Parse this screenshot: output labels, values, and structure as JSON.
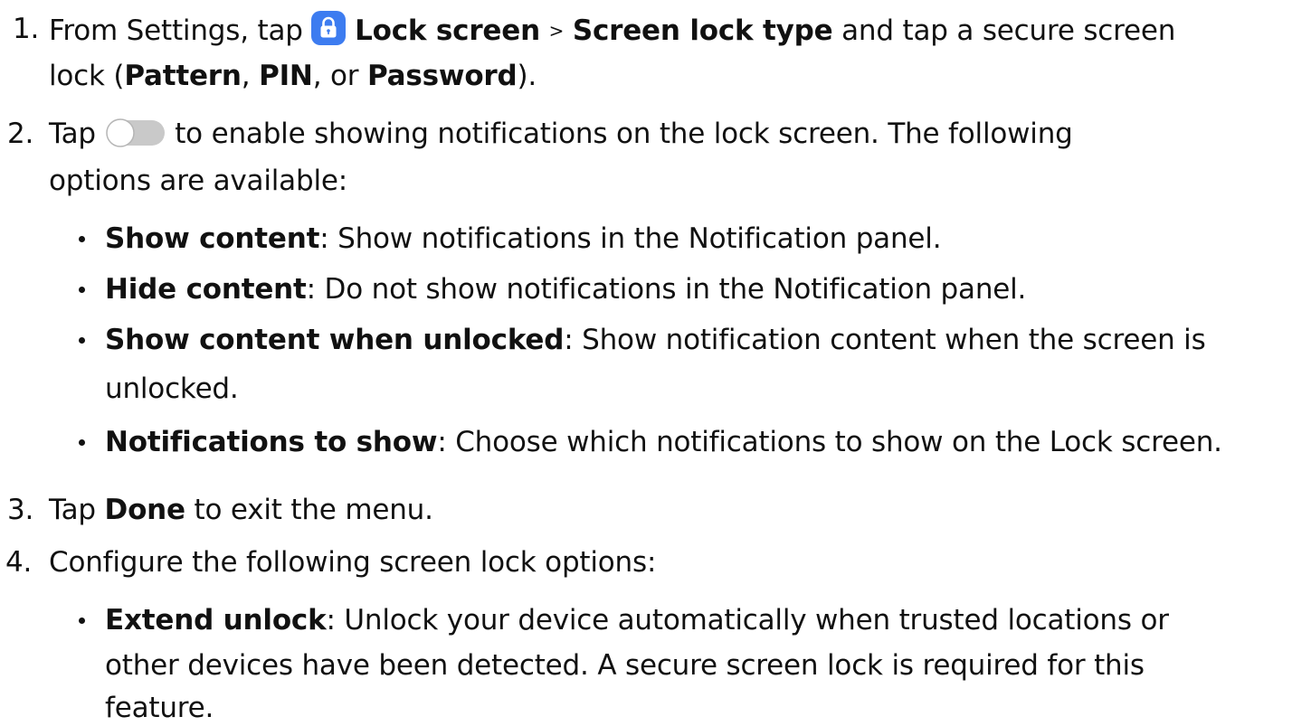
{
  "steps": [
    {
      "num": "1.",
      "t1": "From Settings, tap",
      "icon": "lock-icon",
      "b1": "Lock screen",
      "arrow": ">",
      "b2": "Screen lock type",
      "t2": "and tap a secure screen",
      "t3": "lock (",
      "b3": "Pattern",
      "t4": ",",
      "b4": "PIN",
      "t5": ", or",
      "b5": "Password",
      "t6": ")."
    },
    {
      "num": "2.",
      "t1": "Tap",
      "icon": "toggle-icon",
      "t2": "to enable showing notifications on the lock screen. The following",
      "t3": "options are available:",
      "bullets": [
        {
          "term": "Show content",
          "desc": ": Show notifications in the Notification panel."
        },
        {
          "term": "Hide content",
          "desc": ": Do not show notifications in the Notification panel."
        },
        {
          "term": "Show content when unlocked",
          "desc": ": Show notification content when the screen is",
          "desc2": "unlocked."
        },
        {
          "term": "Notifications to show",
          "desc": ": Choose which notifications to show on the Lock screen."
        }
      ]
    },
    {
      "num": "3.",
      "t1": "Tap",
      "b1": "Done",
      "t2": "to exit the menu."
    },
    {
      "num": "4.",
      "t1": "Configure the following screen lock options:",
      "bullets": [
        {
          "term": "Extend unlock",
          "desc": ": Unlock your device automatically when trusted locations or",
          "desc2": "other devices have been detected. A secure screen lock is required for this",
          "desc3": "feature."
        }
      ]
    }
  ],
  "colors": {
    "text": "#111111",
    "icon_blue": "#3d7cf0",
    "toggle_gray": "#c9c9c9",
    "toggle_knob_border": "#b5b5b5"
  }
}
